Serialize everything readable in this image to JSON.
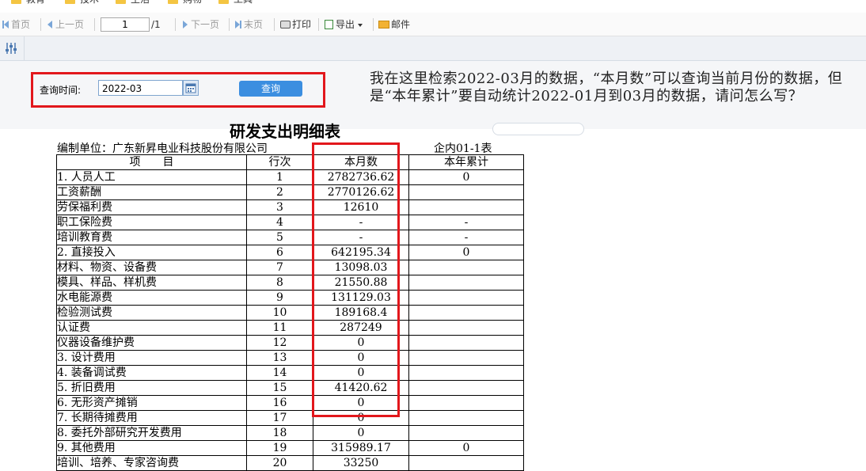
{
  "bookmarks": [
    "教育",
    "技术",
    "生活",
    "购物",
    "工具"
  ],
  "toolbar": {
    "first": "首页",
    "prev": "上一页",
    "page": "1",
    "total": "/1",
    "next": "下一页",
    "last": "末页",
    "print": "打印",
    "export": "导出",
    "mail": "邮件"
  },
  "query": {
    "label": "查询时间:",
    "date": "2022-03",
    "button": "查询"
  },
  "question": "我在这里检索2022-03月的数据，“本月数”可以查询当前月份的数据，但是“本年累计”要自动统计2022-01月到03月的数据，请问怎么写？",
  "report": {
    "title": "研发支出明细表",
    "unit": "编制单位：广东新昇电业科技股份有限公司",
    "code": "企内01-1表",
    "headers": [
      "项　　目",
      "行次",
      "本月数",
      "本年累计"
    ],
    "rows": [
      {
        "item": "1. 人员人工",
        "indent": 0,
        "no": "1",
        "month": "2782736.62",
        "ytd": "0"
      },
      {
        "item": "工资薪酬",
        "indent": 2,
        "no": "2",
        "month": "2770126.62",
        "ytd": ""
      },
      {
        "item": "劳保福利费",
        "indent": 2,
        "no": "3",
        "month": "12610",
        "ytd": ""
      },
      {
        "item": "职工保险费",
        "indent": 1,
        "no": "4",
        "month": "-",
        "ytd": "-"
      },
      {
        "item": "培训教育费",
        "indent": 1,
        "no": "5",
        "month": "-",
        "ytd": "-"
      },
      {
        "item": "2. 直接投入",
        "indent": 0,
        "no": "6",
        "month": "642195.34",
        "ytd": "0"
      },
      {
        "item": "材料、物资、设备费",
        "indent": 2,
        "no": "7",
        "month": "13098.03",
        "ytd": ""
      },
      {
        "item": "模具、样品、样机费",
        "indent": 2,
        "no": "8",
        "month": "21550.88",
        "ytd": ""
      },
      {
        "item": "水电能源费",
        "indent": 2,
        "no": "9",
        "month": "131129.03",
        "ytd": ""
      },
      {
        "item": "检验测试费",
        "indent": 2,
        "no": "10",
        "month": "189168.4",
        "ytd": ""
      },
      {
        "item": "认证费",
        "indent": 2,
        "no": "11",
        "month": "287249",
        "ytd": ""
      },
      {
        "item": "仪器设备维护费",
        "indent": 2,
        "no": "12",
        "month": "0",
        "ytd": ""
      },
      {
        "item": "3. 设计费用",
        "indent": 0,
        "no": "13",
        "month": "0",
        "ytd": ""
      },
      {
        "item": "4. 装备调试费",
        "indent": 0,
        "no": "14",
        "month": "0",
        "ytd": ""
      },
      {
        "item": "5. 折旧费用",
        "indent": 0,
        "no": "15",
        "month": "41420.62",
        "ytd": ""
      },
      {
        "item": "6. 无形资产摊销",
        "indent": 0,
        "no": "16",
        "month": "0",
        "ytd": ""
      },
      {
        "item": "7. 长期待摊费用",
        "indent": 0,
        "no": "17",
        "month": "0",
        "ytd": ""
      },
      {
        "item": "8. 委托外部研究开发费用",
        "indent": 0,
        "no": "18",
        "month": "0",
        "ytd": ""
      },
      {
        "item": "9. 其他费用",
        "indent": 0,
        "no": "19",
        "month": "315989.17",
        "ytd": "0"
      },
      {
        "item": "培训、培养、专家咨询费",
        "indent": 2,
        "no": "20",
        "month": "33250",
        "ytd": ""
      }
    ]
  },
  "colors": {
    "highlight": "#e2171c",
    "button": "#3b8ee0"
  }
}
